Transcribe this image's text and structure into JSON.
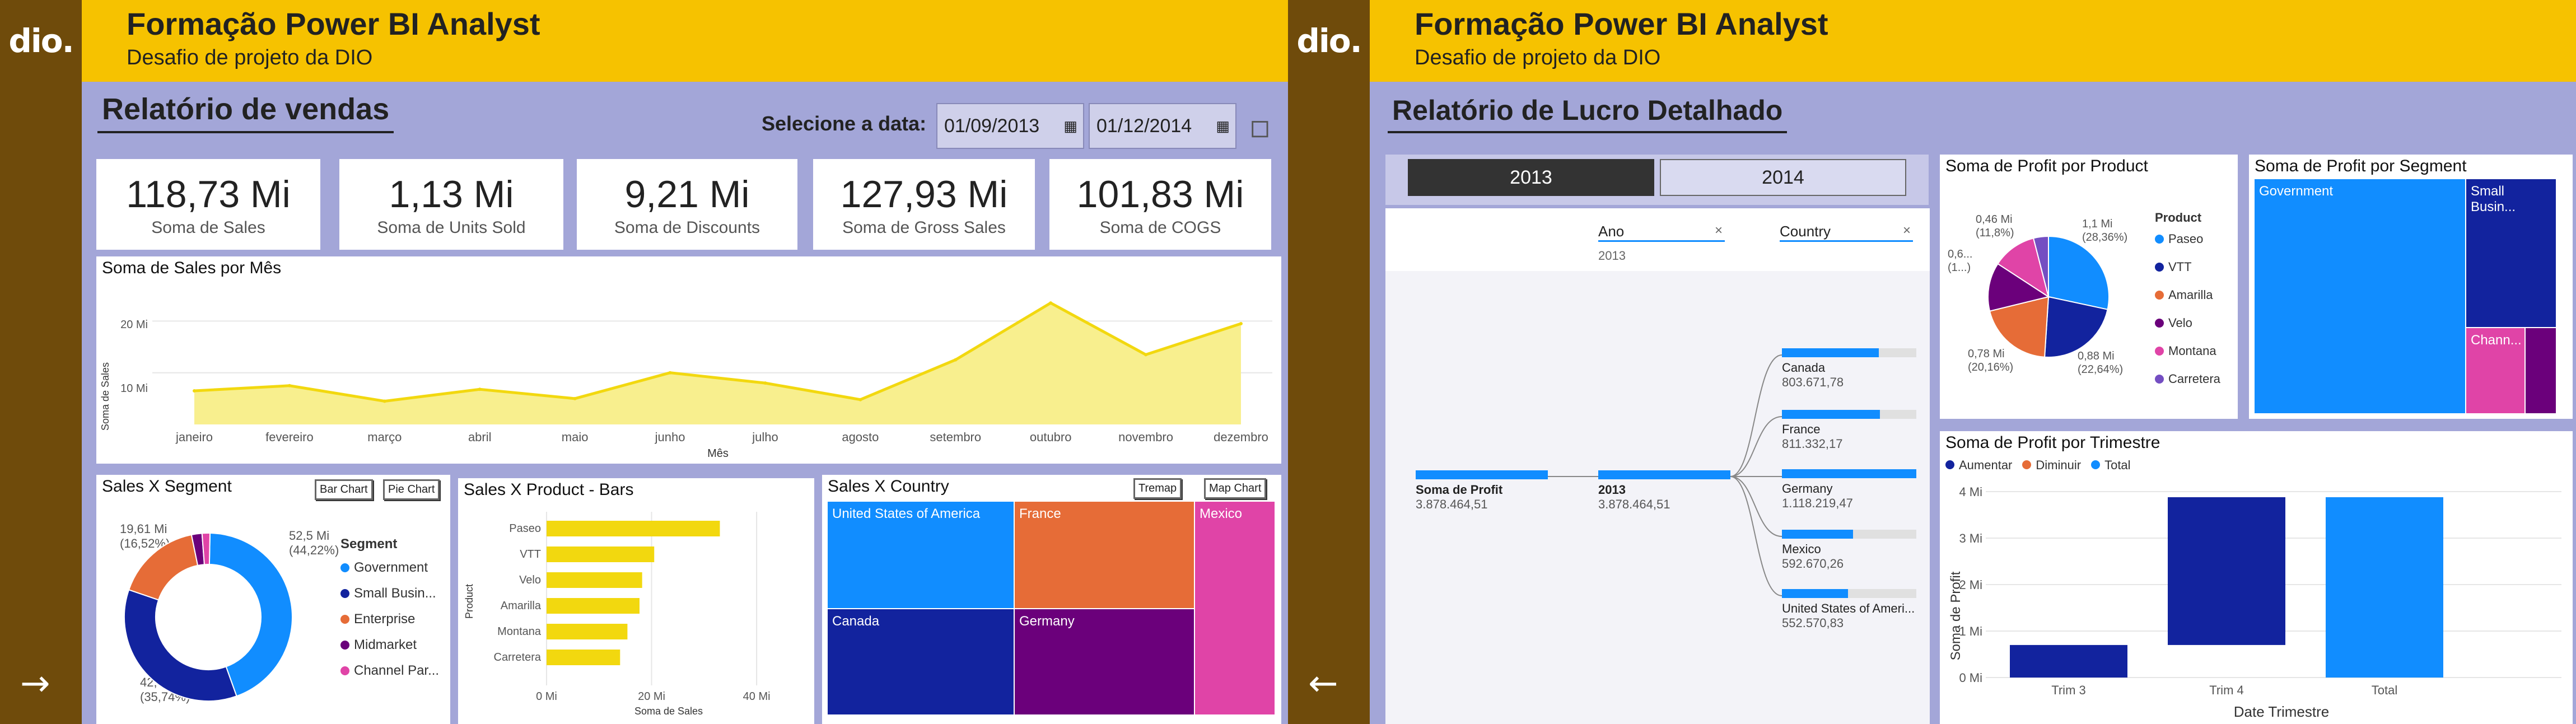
{
  "brand": {
    "logo_text": "dio."
  },
  "left": {
    "header_title": "Formação Power BI Analyst",
    "header_subtitle": "Desafio de projeto da DIO",
    "page_title": "Relatório de vendas",
    "date_label": "Selecione a data:",
    "date_start": "01/09/2013",
    "date_end": "01/12/2014",
    "kpis": [
      {
        "value": "118,73 Mi",
        "label": "Soma de  Sales"
      },
      {
        "value": "1,13 Mi",
        "label": "Soma de Units Sold"
      },
      {
        "value": "9,21 Mi",
        "label": "Soma de Discounts"
      },
      {
        "value": "127,93 Mi",
        "label": "Soma de Gross Sales"
      },
      {
        "value": "101,83 Mi",
        "label": "Soma de COGS"
      }
    ],
    "area_chart": {
      "title": "Soma de Sales por Mês",
      "xlabel": "Mês",
      "ylabel": "Soma de Sales",
      "ytick_10": "10 Mi",
      "ytick_20": "20 Mi"
    },
    "segment": {
      "title": "Sales X Segment",
      "btn_bar": "Bar Chart",
      "btn_pie": "Pie Chart",
      "legend_title": "Segment",
      "label_gov": "52,5 Mi",
      "label_gov_pct": "(44,22%)",
      "label_ent": "19,61 Mi",
      "label_ent_pct": "(16,52%)",
      "label_sb": "42,43 Mi",
      "label_sb_pct": "(35,74%)",
      "legend": [
        "Government",
        "Small Busin...",
        "Enterprise",
        "Midmarket",
        "Channel Par..."
      ]
    },
    "product": {
      "title": "Sales X Product - Bars",
      "xlabel": "Soma de Sales",
      "ylabel": "Product",
      "ticks": [
        "0 Mi",
        "20 Mi",
        "40 Mi"
      ]
    },
    "country": {
      "title": "Sales X Country",
      "btn_tremap": "Tremap",
      "btn_map": "Map Chart",
      "cells": [
        "United States of America",
        "France",
        "Mexico",
        "Canada",
        "Germany"
      ]
    },
    "nav_icon": "arrow-right-icon"
  },
  "right": {
    "header_title": "Formação Power BI Analyst",
    "header_subtitle": "Desafio de projeto da DIO",
    "page_title": "Relatório de Lucro Detalhado",
    "year_buttons": [
      "2013",
      "2014"
    ],
    "decomp": {
      "filter_ano_label": "Ano",
      "filter_ano_value": "2013",
      "filter_country_label": "Country",
      "root_label": "Soma de Profit",
      "root_value": "3.878.464,51",
      "level_label": "2013",
      "level_value": "3.878.464,51",
      "countries": [
        {
          "name": "Canada",
          "value": "803.671,78"
        },
        {
          "name": "France",
          "value": "811.332,17"
        },
        {
          "name": "Germany",
          "value": "1.118.219,47"
        },
        {
          "name": "Mexico",
          "value": "592.670,26"
        },
        {
          "name": "United States of Ameri...",
          "value": "552.570,83"
        }
      ]
    },
    "pie": {
      "title": "Soma de Profit por Product",
      "legend_title": "Product",
      "labels": {
        "a": "0,46 Mi",
        "a_pct": "(11,8%)",
        "b": "1,1 Mi",
        "b_pct": "(28,36%)",
        "c": "0,6...",
        "c_pct": "(1...)",
        "d": "0,78 Mi",
        "d_pct": "(20,16%)",
        "e": "0,88 Mi",
        "e_pct": "(22,64%)"
      },
      "legend": [
        "Paseo",
        "VTT",
        "Amarilla",
        "Velo",
        "Montana",
        "Carretera"
      ]
    },
    "treemap": {
      "title": "Soma de Profit por Segment",
      "cells": [
        "Government",
        "Small Busin...",
        "Chann..."
      ]
    },
    "waterfall": {
      "title": "Soma de Profit por Trimestre",
      "legend": [
        "Aumentar",
        "Diminuir",
        "Total"
      ],
      "xlabel": "Date Trimestre",
      "ylabel": "Soma de Profit",
      "yticks": [
        "4 Mi",
        "3 Mi",
        "2 Mi",
        "1 Mi",
        "0 Mi"
      ]
    },
    "nav_icon": "arrow-left-icon"
  },
  "chart_data": [
    {
      "type": "area",
      "title": "Soma de Sales por Mês",
      "xlabel": "Mês",
      "ylabel": "Soma de Sales",
      "categories": [
        "janeiro",
        "fevereiro",
        "março",
        "abril",
        "maio",
        "junho",
        "julho",
        "agosto",
        "setembro",
        "outubro",
        "novembro",
        "dezembro"
      ],
      "values": [
        6.5,
        7.5,
        4.5,
        6.8,
        5.0,
        10.0,
        8.0,
        4.8,
        12.5,
        23.5,
        13.5,
        19.5
      ],
      "ylim": [
        0,
        26
      ]
    },
    {
      "type": "pie",
      "title": "Sales X Segment",
      "categories": [
        "Government",
        "Small Business",
        "Enterprise",
        "Midmarket",
        "Channel Partners"
      ],
      "values": [
        52.5,
        42.43,
        19.61,
        2.4,
        1.8
      ]
    },
    {
      "type": "bar",
      "title": "Sales X Product - Bars",
      "categories": [
        "Paseo",
        "VTT",
        "Velo",
        "Amarilla",
        "Montana",
        "Carretera"
      ],
      "values": [
        33.0,
        20.5,
        18.2,
        17.7,
        15.4,
        14.0
      ],
      "xlim": [
        0,
        45
      ]
    },
    {
      "type": "pie",
      "title": "Soma de Profit por Product",
      "categories": [
        "Paseo",
        "VTT",
        "Amarilla",
        "Velo",
        "Montana",
        "Carretera"
      ],
      "values": [
        28.36,
        22.64,
        20.16,
        13.0,
        11.8,
        4.0
      ]
    },
    {
      "type": "bar",
      "title": "Soma de Profit por Trimestre",
      "categories": [
        "Trim 3",
        "Trim 4",
        "Total"
      ],
      "series": [
        {
          "name": "Aumentar",
          "values": [
            0.7,
            3.18,
            null
          ]
        },
        {
          "name": "Total",
          "values": [
            null,
            null,
            3.88
          ]
        }
      ],
      "ylim": [
        0,
        4
      ]
    }
  ],
  "colors": {
    "accent": "#f6c200",
    "sidebar": "#6f4b0b",
    "bg": "#a3a6d8",
    "blue": "#118dff",
    "navy": "#12239e",
    "orange": "#e66c37",
    "purple": "#6b007b",
    "pink": "#e044a7",
    "darkpurple": "#744ec2"
  }
}
